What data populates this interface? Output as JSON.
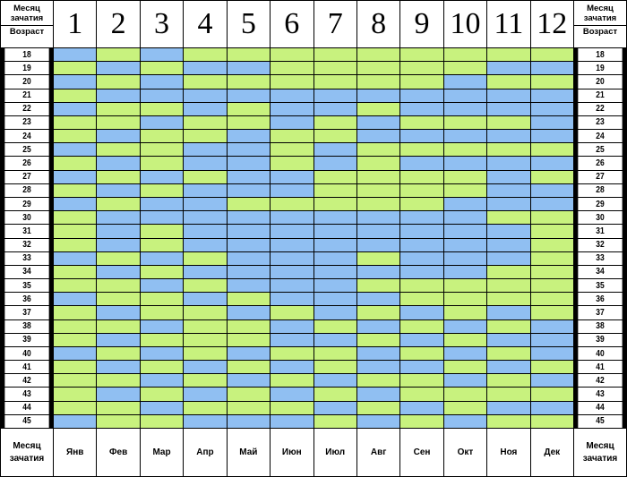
{
  "chart_data": {
    "type": "heatmap",
    "header_left": {
      "line1": "Месяц",
      "line2": "зачатия",
      "line3": "Возраст"
    },
    "header_right": {
      "line1": "Месяц",
      "line2": "зачатия",
      "line3": "Возраст"
    },
    "columns": [
      "1",
      "2",
      "3",
      "4",
      "5",
      "6",
      "7",
      "8",
      "9",
      "10",
      "11",
      "12"
    ],
    "footer_label": {
      "line1": "Месяц",
      "line2": "зачатия"
    },
    "month_names": [
      "Янв",
      "Фев",
      "Мар",
      "Апр",
      "Май",
      "Июн",
      "Июл",
      "Авг",
      "Сен",
      "Окт",
      "Ноя",
      "Дек"
    ],
    "ages": [
      "18",
      "19",
      "20",
      "21",
      "22",
      "23",
      "24",
      "25",
      "26",
      "27",
      "28",
      "29",
      "30",
      "31",
      "32",
      "33",
      "34",
      "35",
      "36",
      "37",
      "38",
      "39",
      "40",
      "41",
      "42",
      "43",
      "44",
      "45"
    ],
    "colors": {
      "B": "#90bff2",
      "G": "#c8f27e"
    },
    "grid": [
      "BGBGGGGGGGGG",
      "GBGBBGGGGGBB",
      "BGBGGGGGGBGG",
      "GBBBBBBBBBBB",
      "BGGBGBBGBBBB",
      "GGBGGBGBGGGB",
      "GBGGBGGBBBBB",
      "BGGBBGBGGGGG",
      "GBGBBGBGBBBB",
      "BGBGBBGGGGBG",
      "GBGBBBGGGGBB",
      "BGBBGGGGGBBB",
      "GBBBBBBBBBGG",
      "GBGBBBBBBBBG",
      "GBGBBBBBBBBG",
      "BGBGBBBGBBBG",
      "GBGBBBBBBBGG",
      "GGBGBBBGGGGG",
      "BGGBGBBBGGGG",
      "GBGGBGBGBGBG",
      "GGBGGBGBGBGB",
      "GBGGGBBGBGBB",
      "BGBGBGGBGBGB",
      "GBGBGBGBBGBG",
      "GGBGBGBGGBGB",
      "GBGBGBGBGGGG",
      "GGBGGGBGBGBB",
      "BGGBBBGBGBGG"
    ]
  }
}
